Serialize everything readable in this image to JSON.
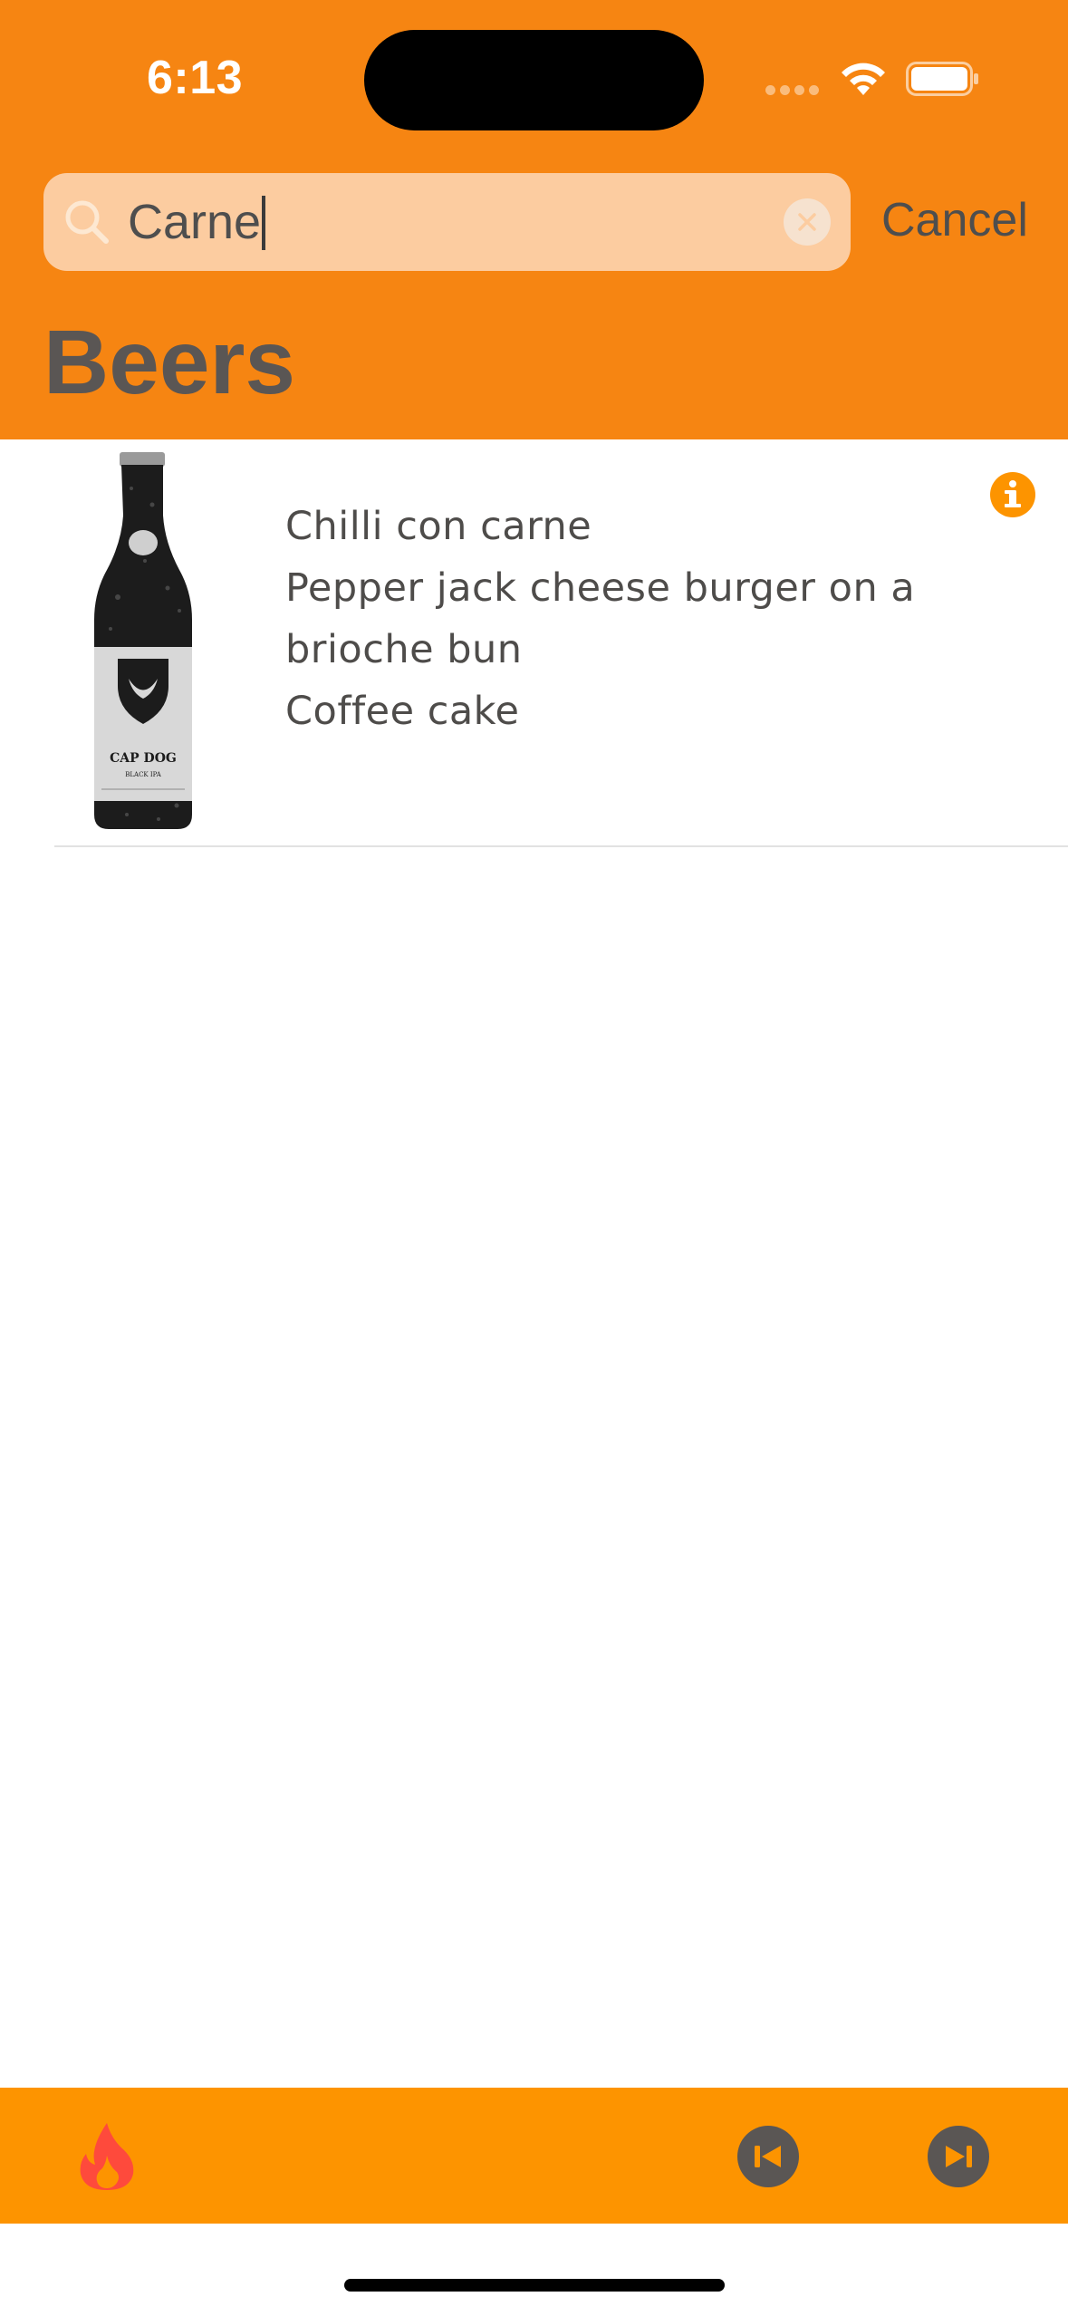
{
  "status_bar": {
    "time": "6:13"
  },
  "search": {
    "value": "Carne",
    "cancel_label": "Cancel"
  },
  "page": {
    "title": "Beers"
  },
  "list": {
    "items": [
      {
        "image_icon": "beer-bottle-icon",
        "bottle_label": "CAP DOG",
        "bottle_sublabel": "BLACK IPA",
        "food_pairing": [
          "Chilli con carne",
          "Pepper jack cheese burger on a",
          "brioche bun",
          "Coffee cake"
        ]
      }
    ]
  },
  "toolbar": {
    "left_icon": "flame-icon",
    "prev_icon": "skip-back-icon",
    "next_icon": "skip-forward-icon"
  },
  "colors": {
    "header": "#f68512",
    "toolbar": "#fd9400",
    "search_field": "#fccca0",
    "info_accent": "#fd9400",
    "flame": "#fe4a3c",
    "text_dark": "#4e4e4e"
  }
}
